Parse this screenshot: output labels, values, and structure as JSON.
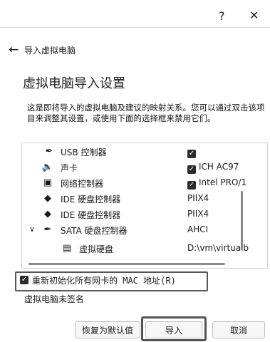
{
  "titlebar": {
    "help": "?",
    "close": "✕"
  },
  "wizard": {
    "title": "导入虚拟电脑"
  },
  "section": {
    "title": "虚拟电脑导入设置",
    "description": "这是即将导入的虚拟电脑及建议的映射关系。您可以通过双击该项目来调整其设置，或使用下面的选择框来禁用它们。"
  },
  "rows": [
    {
      "label": "USB 控制器",
      "value": "",
      "checked": true,
      "icon": "usb-icon"
    },
    {
      "label": "声卡",
      "value": "ICH AC97",
      "checked": true,
      "icon": "speaker-icon"
    },
    {
      "label": "网络控制器",
      "value": "Intel PRO/1",
      "checked": true,
      "icon": "network-card-icon"
    },
    {
      "label": "IDE 硬盘控制器",
      "value": "PIIX4",
      "checked": false,
      "icon": "ide-controller-icon"
    },
    {
      "label": "IDE 硬盘控制器",
      "value": "PIIX4",
      "checked": false,
      "icon": "ide-controller-icon"
    },
    {
      "label": "SATA 硬盘控制器",
      "value": "AHCI",
      "checked": false,
      "icon": "sata-controller-icon"
    },
    {
      "label": "虚拟硬盘",
      "value": "D:\\vm\\virtualb",
      "checked": false,
      "icon": "virtual-disk-icon"
    }
  ],
  "reset_mac": {
    "label": "重新初始化所有网卡的 MAC 地址(R)",
    "checked": true
  },
  "unsigned_label": "虚拟电脑未签名",
  "buttons": {
    "restore_defaults": "恢复为默认值",
    "import": "导入",
    "cancel": "取消"
  }
}
